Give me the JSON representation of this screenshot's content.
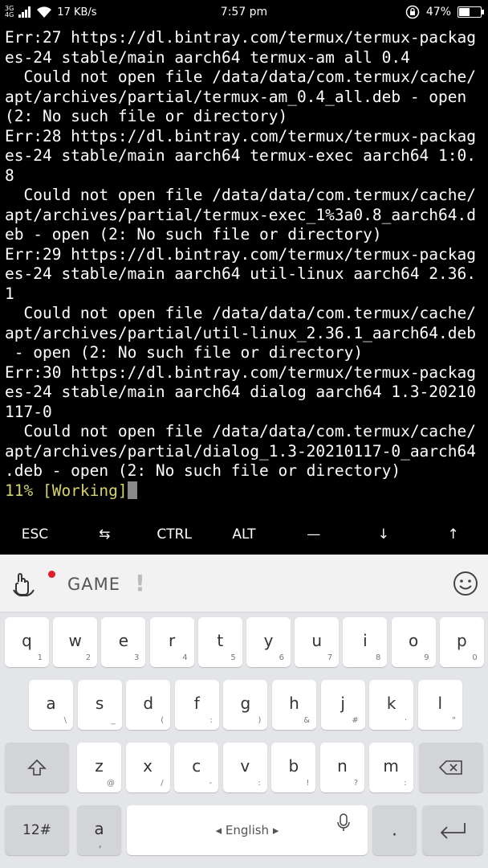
{
  "status_bar": {
    "network_type": "3G",
    "network_sub": "4G",
    "speed": "17 KB/s",
    "time": "7:57 pm",
    "battery": "47%",
    "battery_level": 0.47
  },
  "terminal": {
    "lines": [
      "Err:27 https://dl.bintray.com/termux/termux-packag",
      "es-24 stable/main aarch64 termux-am all 0.4",
      "  Could not open file /data/data/com.termux/cache/",
      "apt/archives/partial/termux-am_0.4_all.deb - open",
      "(2: No such file or directory)",
      "Err:28 https://dl.bintray.com/termux/termux-packag",
      "es-24 stable/main aarch64 termux-exec aarch64 1:0.",
      "8",
      "  Could not open file /data/data/com.termux/cache/",
      "apt/archives/partial/termux-exec_1%3a0.8_aarch64.d",
      "eb - open (2: No such file or directory)",
      "Err:29 https://dl.bintray.com/termux/termux-packag",
      "es-24 stable/main aarch64 util-linux aarch64 2.36.",
      "1",
      "  Could not open file /data/data/com.termux/cache/",
      "apt/archives/partial/util-linux_2.36.1_aarch64.deb",
      " - open (2: No such file or directory)",
      "Err:30 https://dl.bintray.com/termux/termux-packag",
      "es-24 stable/main aarch64 dialog aarch64 1.3-20210",
      "117-0",
      "  Could not open file /data/data/com.termux/cache/",
      "apt/archives/partial/dialog_1.3-20210117-0_aarch64",
      ".deb - open (2: No such file or directory)"
    ],
    "progress_line": "11% [Working]"
  },
  "extra_keys": [
    "ESC",
    "⇆",
    "CTRL",
    "ALT",
    "—",
    "↓",
    "↑"
  ],
  "keyboard": {
    "top_bar": {
      "label": "GAME",
      "mark": "!"
    },
    "row1": [
      {
        "key": "q",
        "sub": "1"
      },
      {
        "key": "w",
        "sub": "2"
      },
      {
        "key": "e",
        "sub": "3"
      },
      {
        "key": "r",
        "sub": "4"
      },
      {
        "key": "t",
        "sub": "5"
      },
      {
        "key": "y",
        "sub": "6"
      },
      {
        "key": "u",
        "sub": "7"
      },
      {
        "key": "i",
        "sub": "8"
      },
      {
        "key": "o",
        "sub": "9"
      },
      {
        "key": "p",
        "sub": "0"
      }
    ],
    "row2": [
      {
        "key": "a",
        "sub": "\\"
      },
      {
        "key": "s",
        "sub": "_"
      },
      {
        "key": "d",
        "sub": "("
      },
      {
        "key": "f",
        "sub": ":"
      },
      {
        "key": "g",
        "sub": ")"
      },
      {
        "key": "h",
        "sub": "&"
      },
      {
        "key": "j",
        "sub": "#"
      },
      {
        "key": "k",
        "sub": "·"
      },
      {
        "key": "l",
        "sub": "\""
      }
    ],
    "row3": [
      {
        "key": "z",
        "sub": "@"
      },
      {
        "key": "x",
        "sub": "/"
      },
      {
        "key": "c",
        "sub": "-"
      },
      {
        "key": "v",
        "sub": ":"
      },
      {
        "key": "b",
        "sub": "!"
      },
      {
        "key": "n",
        "sub": "?"
      },
      {
        "key": "m",
        "sub": ":"
      }
    ],
    "numbers_label": "12#",
    "comma_key": {
      "key": "a",
      "sub": ","
    },
    "space_label": "English",
    "period_label": "."
  }
}
